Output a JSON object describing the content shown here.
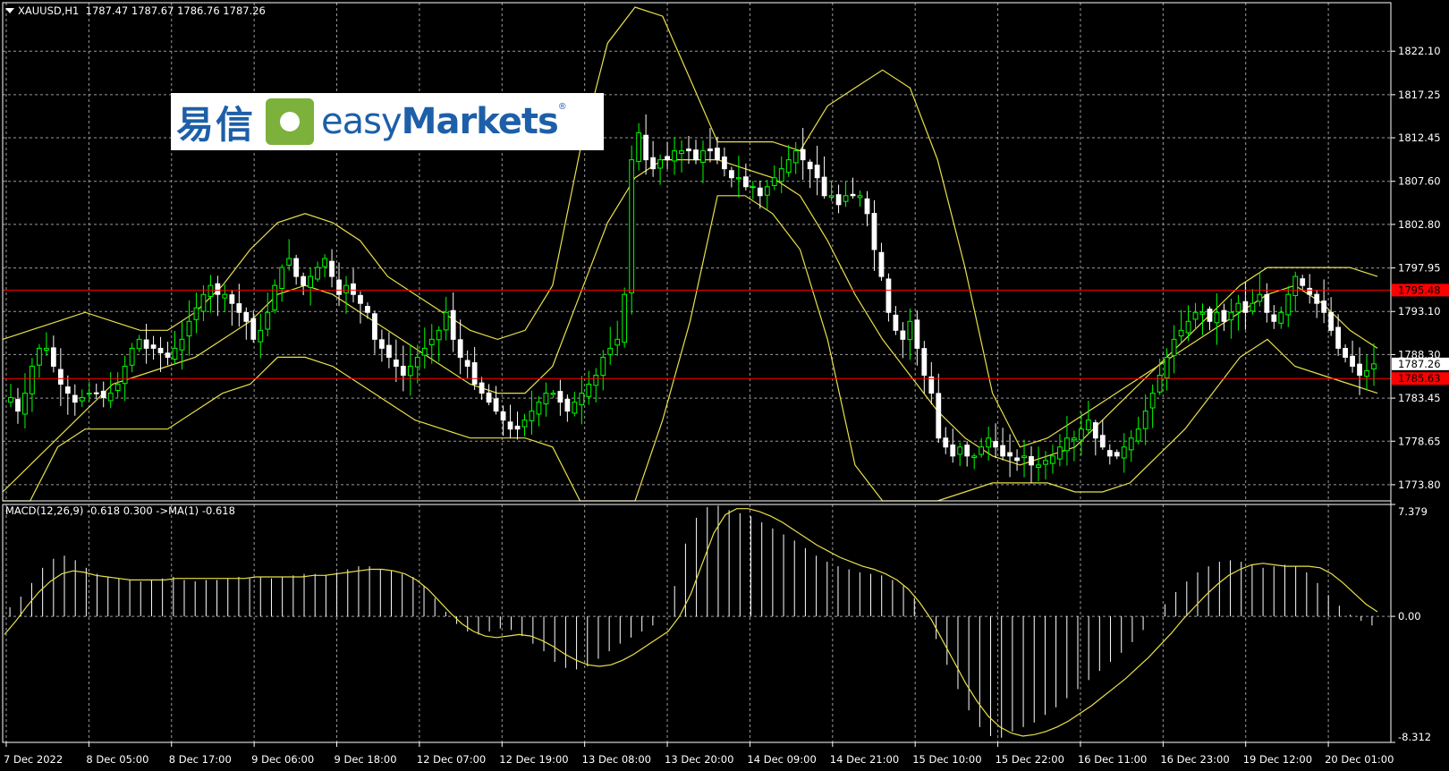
{
  "header": {
    "symbol": "XAUUSD,H1",
    "ohlc": "1787.47 1787.67 1786.76 1787.26"
  },
  "logo": {
    "cn_text": "易信",
    "en_text_light": "easy",
    "en_text_bold": "Markets",
    "reg_mark": "®"
  },
  "macd_header": {
    "label": "MACD(12,26,9) -0.618 0.300  ->MA(1) -0.618"
  },
  "colors": {
    "background": "#000000",
    "grid": "#9a9a9a",
    "bull_candle": "#00ff00",
    "bear_candle": "#ffffff",
    "bands": "#e8e04a",
    "level_line": "#ff0000",
    "price_label_bg": "#ff0000",
    "current_label_bg": "#ffffff",
    "macd_hist": "#ffffff",
    "macd_signal": "#e8e04a"
  },
  "chart_data": [
    {
      "type": "candlestick",
      "symbol": "XAUUSD",
      "timeframe": "H1",
      "y_ticks": [
        1822.1,
        1817.25,
        1812.45,
        1807.6,
        1802.8,
        1797.95,
        1793.1,
        1788.3,
        1783.45,
        1778.65,
        1773.8
      ],
      "y_tick_labels": [
        "1822.10",
        "1817.25",
        "1812.45",
        "1807.60",
        "1802.80",
        "1797.95",
        "1793.10",
        "1788.30",
        "1783.45",
        "1778.65",
        "1773.80"
      ],
      "ylim": [
        1772.0,
        1827.5
      ],
      "x_tick_labels": [
        "7 Dec 2022",
        "8 Dec 05:00",
        "8 Dec 17:00",
        "9 Dec 06:00",
        "9 Dec 18:00",
        "12 Dec 07:00",
        "12 Dec 19:00",
        "13 Dec 08:00",
        "13 Dec 20:00",
        "14 Dec 09:00",
        "14 Dec 21:00",
        "15 Dec 10:00",
        "15 Dec 22:00",
        "16 Dec 11:00",
        "16 Dec 23:00",
        "19 Dec 12:00",
        "20 Dec 01:00"
      ],
      "level_lines": [
        {
          "value": 1795.48,
          "label": "1795.48"
        },
        {
          "value": 1785.63,
          "label": "1785.63"
        }
      ],
      "current_price": {
        "value": 1787.26,
        "label": "1787.26"
      },
      "close_path": [
        1783.5,
        1782,
        1784,
        1787,
        1789,
        1789,
        1787,
        1785,
        1784,
        1783,
        1783.5,
        1784,
        1784,
        1783.5,
        1784,
        1785,
        1787,
        1789,
        1790,
        1789,
        1789,
        1788.5,
        1788,
        1789,
        1790,
        1792,
        1793.5,
        1795,
        1796,
        1795,
        1795,
        1794,
        1793,
        1792,
        1790,
        1791,
        1793,
        1796,
        1798,
        1799,
        1797,
        1796,
        1797,
        1798,
        1799,
        1797,
        1795,
        1796,
        1795,
        1794,
        1793,
        1790,
        1789,
        1788,
        1787,
        1786,
        1787,
        1788,
        1789,
        1790,
        1791,
        1793,
        1790,
        1788,
        1787,
        1785,
        1784,
        1783,
        1782,
        1781,
        1780,
        1780,
        1781,
        1782,
        1783,
        1784,
        1784,
        1783,
        1782,
        1783,
        1784,
        1785,
        1786,
        1788,
        1789,
        1790,
        1795,
        1810,
        1813,
        1810,
        1809,
        1810,
        1810,
        1811,
        1811,
        1811,
        1810,
        1811,
        1811,
        1810,
        1809,
        1808,
        1808,
        1807,
        1807,
        1806,
        1807,
        1808,
        1809,
        1810,
        1811,
        1810,
        1809,
        1808,
        1806,
        1806,
        1805,
        1806,
        1806,
        1806,
        1804,
        1800,
        1797,
        1793,
        1791,
        1790,
        1792,
        1789,
        1786,
        1784,
        1779,
        1778,
        1777,
        1778,
        1777,
        1777,
        1778,
        1779,
        1778,
        1777,
        1777,
        1776.5,
        1777,
        1776,
        1776,
        1776.5,
        1777,
        1778,
        1779,
        1779,
        1780,
        1781,
        1779,
        1778,
        1777,
        1777,
        1778,
        1779,
        1780,
        1782,
        1784,
        1786,
        1788,
        1790,
        1791,
        1792,
        1793,
        1793,
        1792,
        1793,
        1792,
        1793,
        1794,
        1793,
        1794,
        1795,
        1793,
        1792,
        1793,
        1795,
        1797,
        1796,
        1795,
        1794,
        1793,
        1791,
        1789,
        1788,
        1787,
        1786,
        1786.5,
        1787.26
      ],
      "bands": {
        "upper": [
          1790,
          1791,
          1792,
          1793,
          1792,
          1791,
          1791,
          1793,
          1796,
          1800,
          1803,
          1804,
          1803,
          1801,
          1797,
          1795,
          1793,
          1791,
          1790,
          1791,
          1796,
          1811,
          1823,
          1827,
          1826,
          1819,
          1812,
          1812,
          1812,
          1811,
          1816,
          1818,
          1820,
          1818,
          1810,
          1798,
          1784,
          1778,
          1779,
          1781,
          1783,
          1785,
          1787,
          1790,
          1793,
          1796,
          1798,
          1798,
          1798,
          1798,
          1797
        ],
        "middle": [
          1773,
          1776,
          1779,
          1782,
          1785,
          1786,
          1787,
          1788,
          1790,
          1792,
          1795,
          1796,
          1795,
          1793,
          1791,
          1789,
          1787,
          1785,
          1784,
          1784,
          1787,
          1795,
          1803,
          1808,
          1810,
          1810,
          1810,
          1809,
          1808,
          1806,
          1801,
          1795,
          1790,
          1786,
          1782,
          1779,
          1777,
          1776,
          1777,
          1778,
          1781,
          1784,
          1787,
          1789,
          1791,
          1793,
          1795,
          1796,
          1794,
          1791,
          1789
        ],
        "lower": [
          1768,
          1768,
          1778,
          1780,
          1780,
          1780,
          1780,
          1782,
          1784,
          1785,
          1788,
          1788,
          1787,
          1785,
          1783,
          1781,
          1780,
          1779,
          1779,
          1779,
          1778,
          1768,
          1765,
          1772,
          1781,
          1792,
          1806,
          1806,
          1804,
          1800,
          1790,
          1776,
          1765,
          1763,
          1768,
          1773,
          1774,
          1774,
          1774,
          1773,
          1773,
          1774,
          1777,
          1780,
          1784,
          1788,
          1790,
          1787,
          1786,
          1785,
          1784
        ]
      }
    },
    {
      "type": "macd",
      "title": "MACD(12,26,9) -0.618 0.300  ->MA(1) -0.618",
      "y_ticks": [
        7.379,
        0.0,
        -8.312
      ],
      "y_tick_labels": [
        "7.379",
        "0.00",
        "-8.312"
      ],
      "ylim": [
        -8.312,
        7.379
      ],
      "histogram": [
        0.6,
        1.3,
        2.2,
        3.2,
        3.8,
        4.0,
        3.7,
        3.2,
        2.8,
        2.6,
        2.5,
        2.4,
        2.3,
        2.4,
        2.5,
        2.6,
        2.4,
        2.3,
        2.4,
        2.4,
        2.5,
        2.6,
        2.5,
        2.6,
        2.5,
        2.6,
        2.7,
        2.8,
        2.8,
        2.7,
        2.9,
        3.1,
        3.3,
        3.3,
        3.1,
        3.0,
        2.8,
        2.6,
        2.0,
        1.2,
        0.3,
        -0.5,
        -1.0,
        -1.2,
        -1.0,
        -0.8,
        -0.9,
        -1.3,
        -1.8,
        -2.3,
        -3.0,
        -3.4,
        -3.5,
        -3.3,
        -2.8,
        -2.3,
        -1.8,
        -1.4,
        -1.0,
        -0.6,
        0.0,
        2.0,
        4.8,
        6.5,
        7.2,
        7.3,
        7.0,
        6.8,
        6.6,
        6.2,
        5.8,
        5.4,
        5.0,
        4.5,
        4.0,
        3.6,
        3.3,
        3.1,
        2.9,
        2.8,
        2.7,
        2.4,
        2.0,
        1.2,
        0.0,
        -1.5,
        -3.2,
        -4.8,
        -6.2,
        -7.3,
        -7.9,
        -8.0,
        -7.6,
        -7.3,
        -7.0,
        -6.5,
        -6.0,
        -5.4,
        -4.8,
        -4.2,
        -3.6,
        -3.0,
        -2.4,
        -1.7,
        -0.9,
        0.0,
        0.8,
        1.6,
        2.3,
        2.9,
        3.3,
        3.6,
        3.7,
        3.6,
        3.4,
        3.2,
        3.3,
        3.4,
        3.3,
        2.9,
        2.2,
        1.4,
        0.7,
        0.1,
        -0.3,
        -0.6
      ],
      "signal": [
        -1.2,
        -0.3,
        0.7,
        1.6,
        2.3,
        2.8,
        3.0,
        2.9,
        2.7,
        2.6,
        2.5,
        2.4,
        2.4,
        2.4,
        2.4,
        2.5,
        2.5,
        2.5,
        2.5,
        2.5,
        2.5,
        2.5,
        2.6,
        2.6,
        2.6,
        2.6,
        2.6,
        2.7,
        2.7,
        2.8,
        2.9,
        3.0,
        3.1,
        3.1,
        3.0,
        2.8,
        2.4,
        1.8,
        1.0,
        0.2,
        -0.5,
        -1.0,
        -1.3,
        -1.4,
        -1.3,
        -1.2,
        -1.3,
        -1.6,
        -2.0,
        -2.5,
        -2.9,
        -3.2,
        -3.3,
        -3.2,
        -2.9,
        -2.5,
        -2.0,
        -1.5,
        -1.0,
        0.0,
        1.5,
        3.5,
        5.5,
        6.7,
        7.1,
        7.1,
        6.9,
        6.6,
        6.2,
        5.7,
        5.2,
        4.7,
        4.3,
        3.9,
        3.6,
        3.3,
        3.1,
        2.8,
        2.4,
        1.8,
        0.9,
        -0.2,
        -1.6,
        -3.0,
        -4.4,
        -5.6,
        -6.6,
        -7.3,
        -7.7,
        -7.9,
        -7.8,
        -7.6,
        -7.3,
        -6.9,
        -6.4,
        -5.9,
        -5.3,
        -4.7,
        -4.1,
        -3.4,
        -2.7,
        -1.9,
        -1.1,
        -0.2,
        0.6,
        1.4,
        2.1,
        2.7,
        3.1,
        3.4,
        3.5,
        3.4,
        3.3,
        3.3,
        3.3,
        3.2,
        2.8,
        2.2,
        1.5,
        0.8,
        0.3
      ]
    }
  ]
}
